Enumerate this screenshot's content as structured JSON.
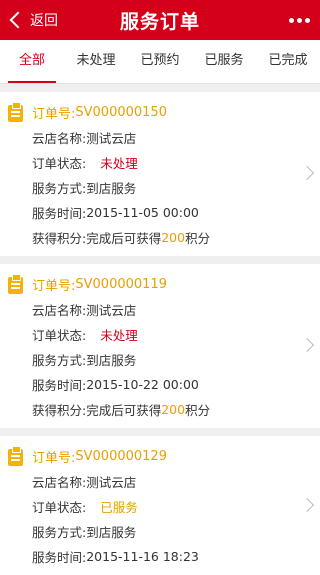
{
  "header": {
    "back_label": "返回",
    "title": "服务订单"
  },
  "tabs": [
    {
      "label": "全部",
      "active": true
    },
    {
      "label": "未处理",
      "active": false
    },
    {
      "label": "已预约",
      "active": false
    },
    {
      "label": "已服务",
      "active": false
    },
    {
      "label": "已完成",
      "active": false
    }
  ],
  "labels": {
    "order_no": "订单号:",
    "store": "云店名称:",
    "status": "订单状态:",
    "method": "服务方式:",
    "time": "服务时间:",
    "points": "获得积分:",
    "points_prefix": "完成后可获得",
    "points_suffix": "积分"
  },
  "orders": [
    {
      "order_no": "SV000000150",
      "store": "测试云店",
      "status": "未处理",
      "method": "到店服务",
      "time": "2015-11-05 00:00",
      "points": "200"
    },
    {
      "order_no": "SV000000119",
      "store": "测试云店",
      "status": "未处理",
      "method": "到店服务",
      "time": "2015-10-22 00:00",
      "points": "200"
    },
    {
      "order_no": "SV000000129",
      "store": "测试云店",
      "status": "已服务",
      "method": "到店服务",
      "time": "2015-11-16 18:23"
    }
  ],
  "colors": {
    "brand_red": "#d4001a",
    "accent_orange": "#e8a000"
  }
}
